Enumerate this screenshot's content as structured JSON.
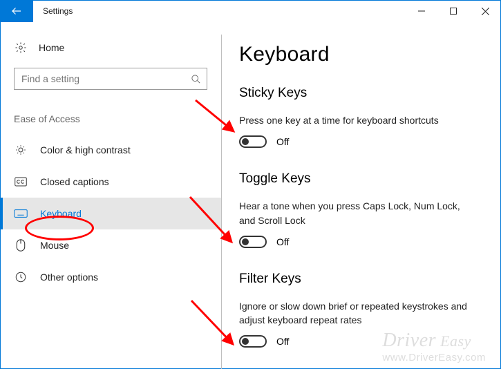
{
  "window": {
    "title": "Settings"
  },
  "sidebar": {
    "home": "Home",
    "search_placeholder": "Find a setting",
    "category": "Ease of Access",
    "items": [
      {
        "label": "Color & high contrast"
      },
      {
        "label": "Closed captions"
      },
      {
        "label": "Keyboard"
      },
      {
        "label": "Mouse"
      },
      {
        "label": "Other options"
      }
    ]
  },
  "main": {
    "title": "Keyboard",
    "sections": [
      {
        "title": "Sticky Keys",
        "desc": "Press one key at a time for keyboard shortcuts",
        "state": "Off"
      },
      {
        "title": "Toggle Keys",
        "desc": "Hear a tone when you press Caps Lock, Num Lock, and Scroll Lock",
        "state": "Off"
      },
      {
        "title": "Filter Keys",
        "desc": "Ignore or slow down brief or repeated keystrokes and adjust keyboard repeat rates",
        "state": "Off"
      }
    ]
  },
  "watermark": {
    "brand": "Driver",
    "suffix": " Easy",
    "url": "www.DriverEasy.com"
  }
}
